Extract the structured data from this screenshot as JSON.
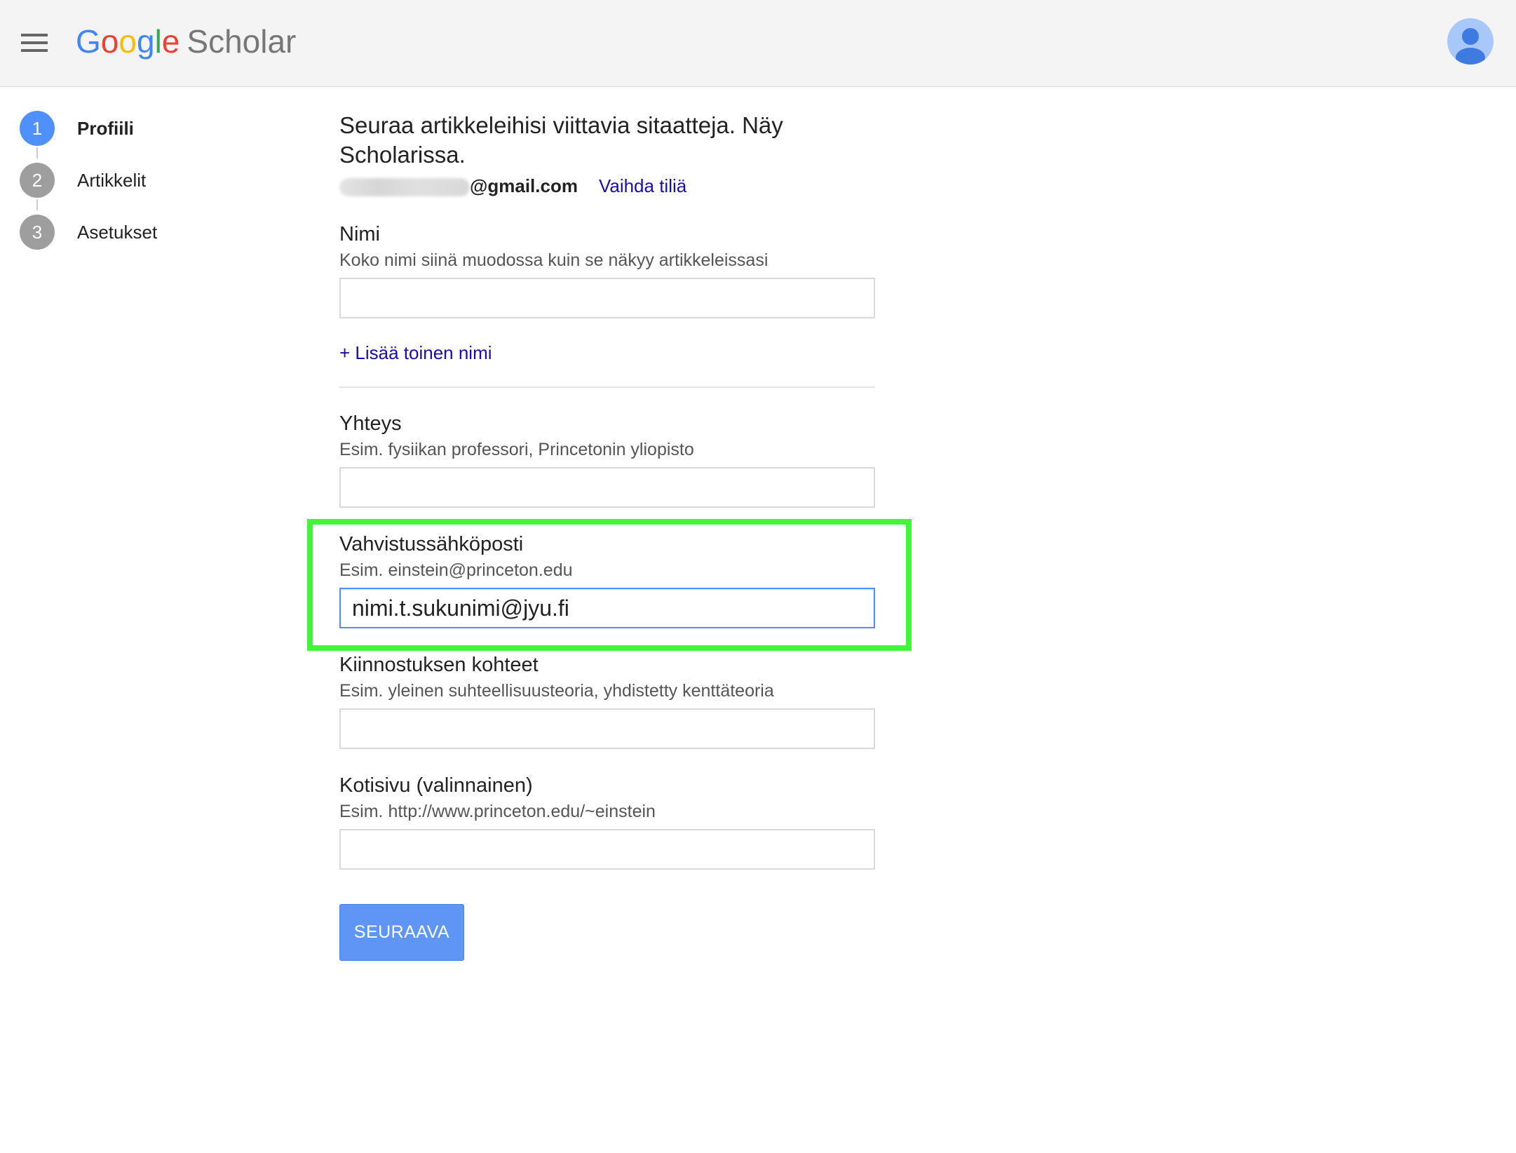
{
  "header": {
    "logo": {
      "letters": [
        {
          "char": "G",
          "color": "#4285f4"
        },
        {
          "char": "o",
          "color": "#ea4335"
        },
        {
          "char": "o",
          "color": "#fbbc05"
        },
        {
          "char": "g",
          "color": "#4285f4"
        },
        {
          "char": "l",
          "color": "#34a853"
        },
        {
          "char": "e",
          "color": "#ea4335"
        }
      ],
      "product": "Scholar"
    },
    "menu_icon": "hamburger-menu-icon",
    "avatar_icon": "account-avatar-icon"
  },
  "steps": [
    {
      "number": "1",
      "label": "Profiili",
      "active": true
    },
    {
      "number": "2",
      "label": "Artikkelit",
      "active": false
    },
    {
      "number": "3",
      "label": "Asetukset",
      "active": false
    }
  ],
  "intro": {
    "text": "Seuraa artikkeleihisi viittavia sitaatteja. Näy Scholarissa."
  },
  "account": {
    "email_domain": "@gmail.com",
    "switch_account_label": "Vaihda tiliä"
  },
  "form": {
    "name": {
      "label": "Nimi",
      "hint": "Koko nimi siinä muodossa kuin se näkyy artikkeleissasi",
      "value": ""
    },
    "add_name_label": "+ Lisää toinen nimi",
    "affiliation": {
      "label": "Yhteys",
      "hint": "Esim. fysiikan professori, Princetonin yliopisto",
      "value": ""
    },
    "verification_email": {
      "label": "Vahvistussähköposti",
      "hint": "Esim. einstein@princeton.edu",
      "value": "nimi.t.sukunimi@jyu.fi"
    },
    "interests": {
      "label": "Kiinnostuksen kohteet",
      "hint": "Esim. yleinen suhteellisuusteoria, yhdistetty kenttäteoria",
      "value": ""
    },
    "homepage": {
      "label": "Kotisivu (valinnainen)",
      "hint": "Esim. http://www.princeton.edu/~einstein",
      "value": ""
    },
    "next_label": "SEURAAVA"
  },
  "colors": {
    "accent_blue": "#4d90fe",
    "button_blue": "#5f96f6",
    "link_blue": "#1a0dab",
    "highlight_green": "#43f53a",
    "step_inactive": "#9e9e9e"
  }
}
